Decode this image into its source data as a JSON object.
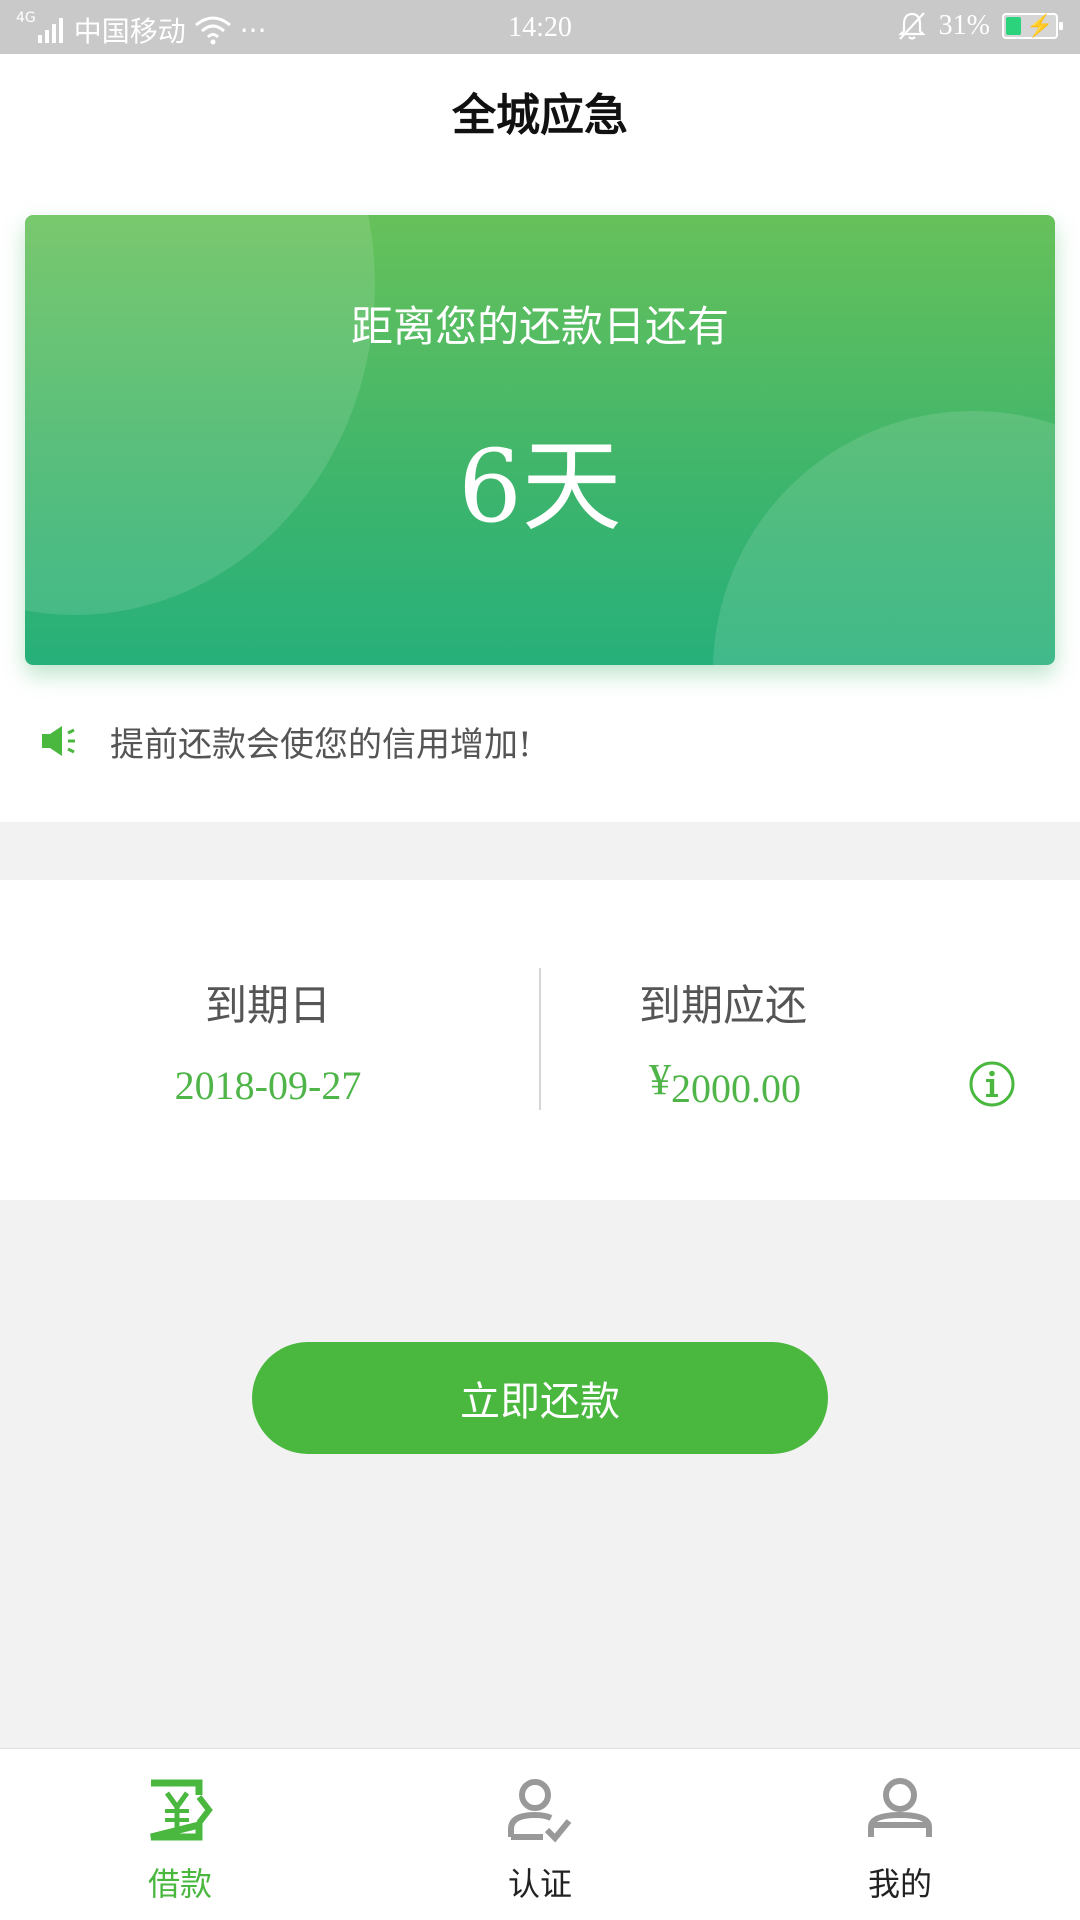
{
  "status_bar": {
    "network_type": "4G",
    "carrier": "中国移动",
    "more": "···",
    "time": "14:20",
    "battery_percent": "31%",
    "battery_level": 0.31
  },
  "header": {
    "title": "全城应急"
  },
  "countdown": {
    "subtitle": "距离您的还款日还有",
    "days": "6天"
  },
  "notice": {
    "text": "提前还款会使您的信用增加!"
  },
  "due": {
    "date_label": "到期日",
    "date_value": "2018-09-27",
    "amount_label": "到期应还",
    "currency": "¥",
    "amount_value": "2000.00"
  },
  "actions": {
    "repay_label": "立即还款"
  },
  "tabs": [
    {
      "label": "借款",
      "icon": "loan-icon"
    },
    {
      "label": "认证",
      "icon": "verify-user-icon"
    },
    {
      "label": "我的",
      "icon": "profile-icon"
    }
  ],
  "colors": {
    "accent": "#4ab83f",
    "card_top": "#67c15a",
    "card_bottom": "#27b07a",
    "inactive_icon": "#999999"
  }
}
